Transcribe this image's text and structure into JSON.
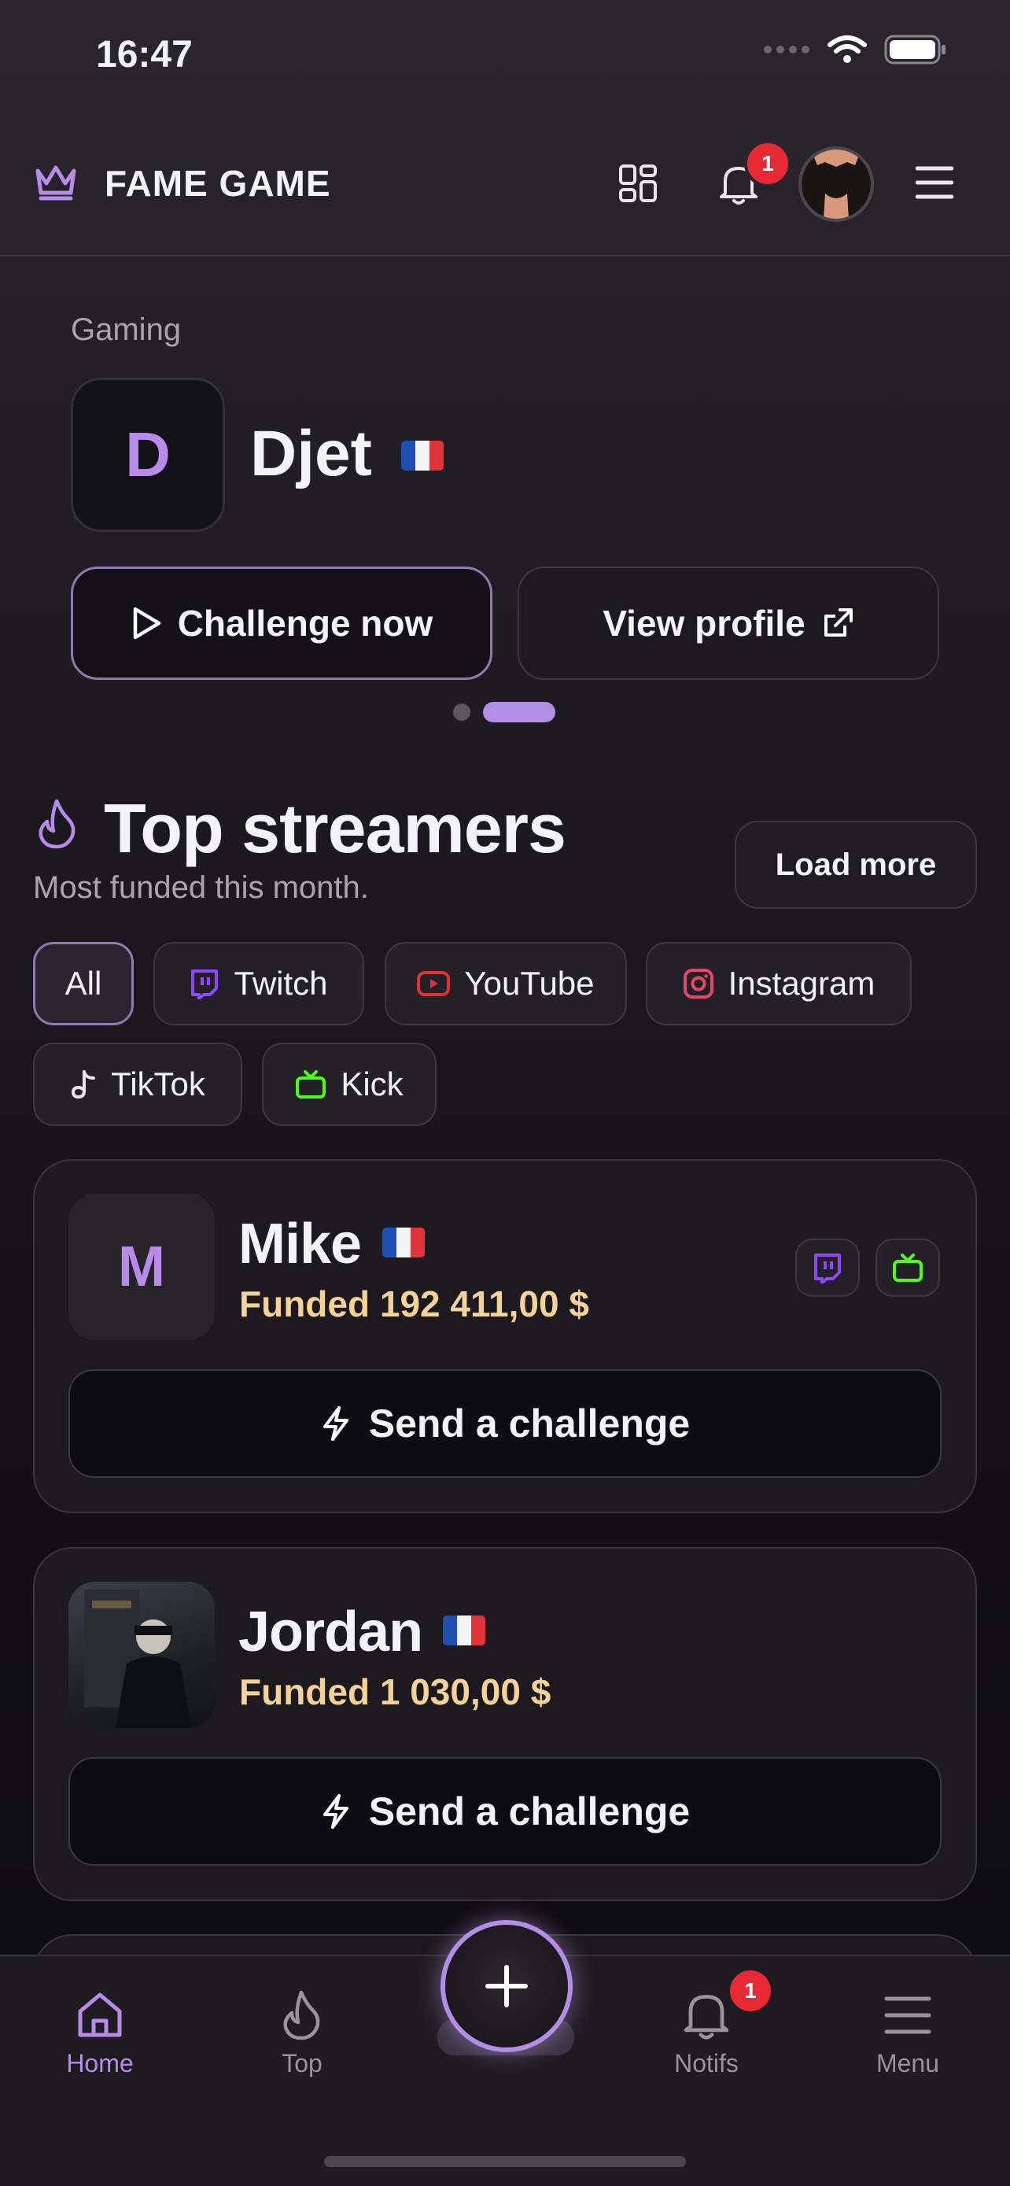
{
  "status": {
    "time": "16:47"
  },
  "header": {
    "brand": "FAME GAME",
    "notif_count": "1"
  },
  "featured": {
    "category": "Gaming",
    "initial": "D",
    "name": "Djet",
    "challenge_label": "Challenge now",
    "view_label": "View profile"
  },
  "top": {
    "title": "Top streamers",
    "subtitle": "Most funded this month.",
    "load_more": "Load more",
    "filters": [
      "All",
      "Twitch",
      "YouTube",
      "Instagram",
      "TikTok",
      "Kick"
    ]
  },
  "streamers": [
    {
      "initial": "M",
      "name": "Mike",
      "funded": "Funded 192 411,00 $",
      "action": "Send a challenge",
      "platforms": [
        "twitch-icon",
        "kick-icon"
      ]
    },
    {
      "initial": "",
      "name": "Jordan",
      "funded": "Funded 1 030,00 $",
      "action": "Send a challenge",
      "platforms": []
    }
  ],
  "tabbar": {
    "home": "Home",
    "top": "Top",
    "notifs": "Notifs",
    "menu": "Menu",
    "notif_count": "1"
  },
  "colors": {
    "accent": "#b88be8",
    "funded": "#f4d29a",
    "badge": "#e62934"
  }
}
